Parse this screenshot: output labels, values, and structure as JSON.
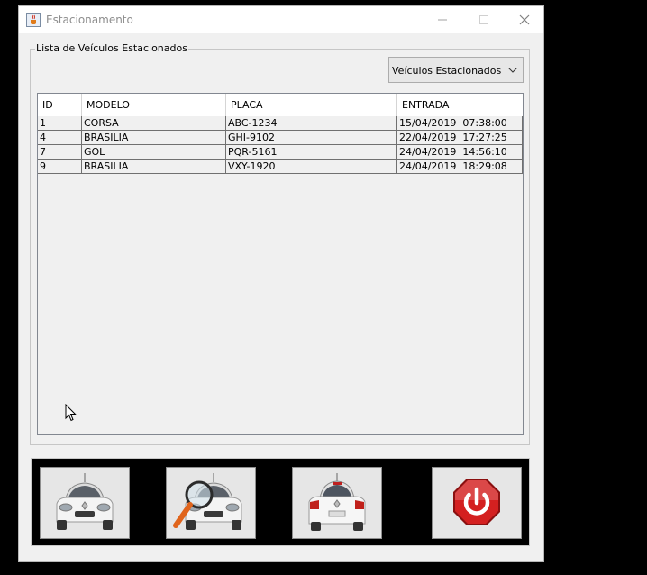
{
  "window": {
    "title": "Estacionamento",
    "icon": "java-cup-icon",
    "controls": [
      "minimize-icon",
      "maximize-icon",
      "close-icon"
    ]
  },
  "group": {
    "title": "Lista de Veículos Estacionados"
  },
  "filter": {
    "selected": "Veículos Estacionados"
  },
  "table": {
    "columns": [
      "ID",
      "MODELO",
      "PLACA",
      "ENTRADA"
    ],
    "rows": [
      [
        "1",
        "CORSA",
        "ABC-1234",
        "15/04/2019  07:38:00"
      ],
      [
        "4",
        "BRASILIA",
        "GHI-9102",
        "22/04/2019  17:27:25"
      ],
      [
        "7",
        "GOL",
        "PQR-5161",
        "24/04/2019  14:56:10"
      ],
      [
        "9",
        "BRASILIA",
        "VXY-1920",
        "24/04/2019  18:29:08"
      ]
    ]
  },
  "toolbar": {
    "buttons": [
      {
        "icon": "car-front-icon"
      },
      {
        "icon": "car-search-icon"
      },
      {
        "icon": "car-rear-icon"
      },
      {
        "icon": "power-off-icon",
        "color": "#d42020"
      }
    ]
  }
}
